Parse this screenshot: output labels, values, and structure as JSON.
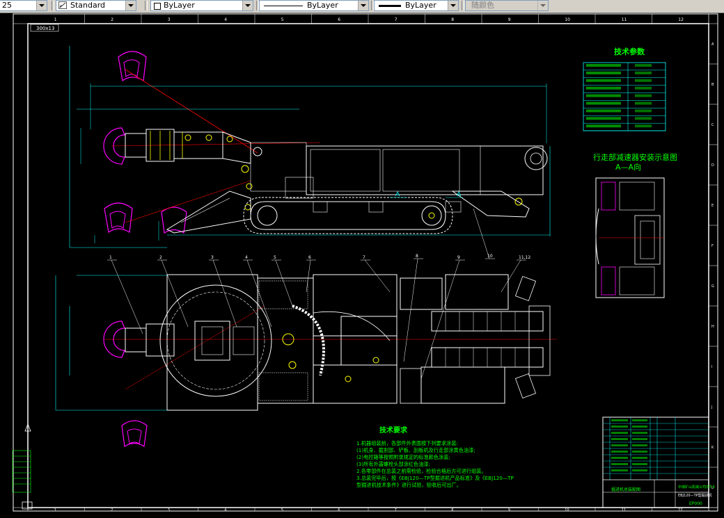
{
  "toolbar": {
    "scale_value": "25",
    "text_style": "Standard",
    "layer": "ByLayer",
    "linetype": "ByLayer",
    "lineweight": "ByLayer",
    "color": "随颜色"
  },
  "drawing": {
    "scale_label": "300x13",
    "tech_params_title": "技术参数",
    "section_title": "行走部减速器安装示意图",
    "section_sub": "A—A向",
    "tech_req_title": "技术要求",
    "tech_req_lines": [
      "1.机器组装前，各部件外表面按下列要求涂装:",
      "  (1)机身、截割部、铲板、刮板机及行走部涂黄色油漆;",
      "  (2)电控箱等按照附录规定的标准颜色涂装;",
      "  (3)所有外露螺栓头部涂红色油漆;",
      "2.各零部件在总装之前需检验，检验合格后方可进行组装。",
      "3.总装完毕后，按《EBJ120—TP型掘进机产品标准》及《EBJ120—TP",
      "  型掘进机技术条件》进行试验，验收后可出厂。"
    ],
    "ruler_top": [
      "1",
      "2",
      "3",
      "4",
      "5",
      "6",
      "7",
      "8",
      "9",
      "10",
      "11",
      "12"
    ],
    "ruler_right": [
      "A",
      "B",
      "C",
      "D",
      "E",
      "F",
      "G",
      "H",
      "I",
      "J",
      "K",
      "L"
    ],
    "callouts_top": [
      "1",
      "2",
      "3",
      "4",
      "5",
      "6",
      "7",
      "8",
      "9",
      "10",
      "11,12"
    ],
    "title_block": {
      "company": "中煤矿山机械公司(ET-4",
      "model": "EBJ120—TP型掘进机",
      "drawing_name": "掘进机总装配图",
      "code": "EP000"
    }
  }
}
